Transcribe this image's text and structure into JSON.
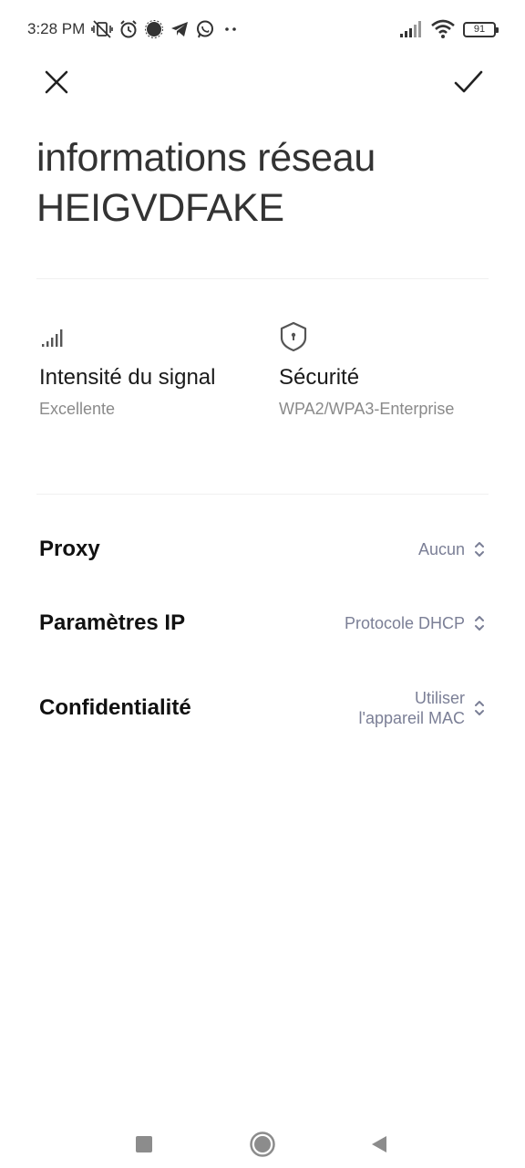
{
  "status_bar": {
    "time": "3:28 PM",
    "battery_level": "91",
    "left_icons": [
      "muted-vibrate-icon",
      "alarm-icon",
      "signal-app-icon",
      "telegram-icon",
      "whatsapp-icon",
      "more-dots-icon"
    ],
    "right_icons": [
      "cellular-signal-icon",
      "wifi-icon",
      "battery-icon"
    ]
  },
  "toolbar": {
    "close_icon": "close-icon",
    "confirm_icon": "check-icon"
  },
  "title": {
    "line1": "informations réseau",
    "line2": "HEIGVDFAKE"
  },
  "info": {
    "signal": {
      "icon": "signal-strength-icon",
      "label": "Intensité du signal",
      "value": "Excellente"
    },
    "security": {
      "icon": "shield-icon",
      "label": "Sécurité",
      "value": "WPA2/WPA3-Enterprise"
    }
  },
  "settings": {
    "proxy": {
      "label": "Proxy",
      "value": "Aucun"
    },
    "ip": {
      "label": "Paramètres IP",
      "value": "Protocole DHCP"
    },
    "privacy": {
      "label": "Confidentialité",
      "value_line1": "Utiliser",
      "value_line2": "l'appareil MAC"
    }
  },
  "nav": {
    "recents": "recents-square-icon",
    "home": "home-circle-icon",
    "back": "back-triangle-icon"
  },
  "colors": {
    "accent_value": "#7b7f96",
    "secondary_text": "#8a8a8a",
    "divider": "#f0f0f0"
  }
}
